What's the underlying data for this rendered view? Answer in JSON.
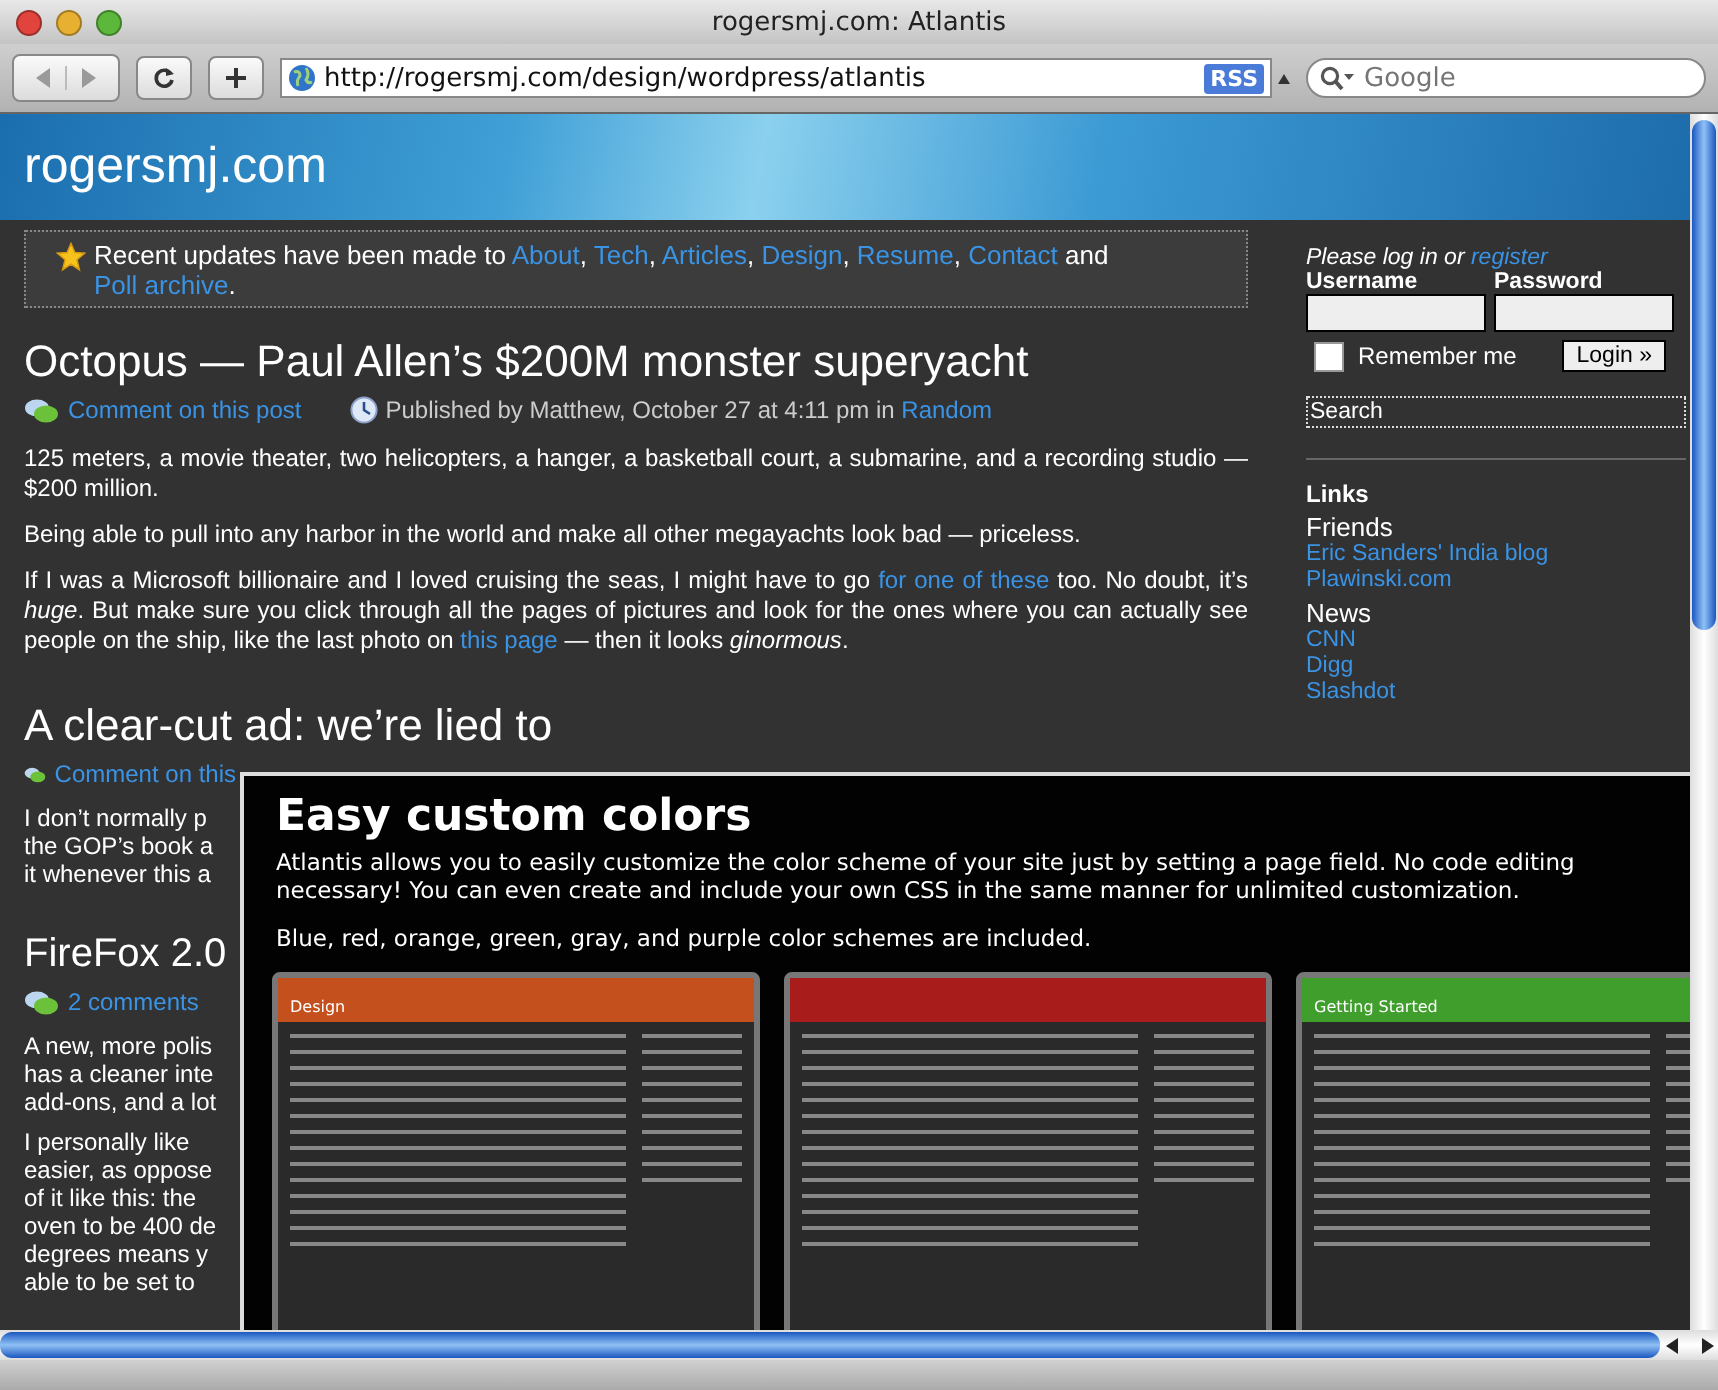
{
  "window": {
    "title": "rogersmj.com: Atlantis"
  },
  "toolbar": {
    "url": "http://rogersmj.com/design/wordpress/atlantis",
    "rss_badge": "RSS",
    "search": {
      "placeholder": "Google"
    }
  },
  "site": {
    "title": "rogersmj.com"
  },
  "notice": [
    {
      "text": "Recent updates have been made to ",
      "link": false
    },
    {
      "text": "About",
      "link": true
    },
    {
      "text": ", ",
      "link": false
    },
    {
      "text": "Tech",
      "link": true
    },
    {
      "text": ", ",
      "link": false
    },
    {
      "text": "Articles",
      "link": true
    },
    {
      "text": ", ",
      "link": false
    },
    {
      "text": "Design",
      "link": true
    },
    {
      "text": ", ",
      "link": false
    },
    {
      "text": "Resume",
      "link": true
    },
    {
      "text": ", ",
      "link": false
    },
    {
      "text": "Contact",
      "link": true
    },
    {
      "text": " and ",
      "link": false
    },
    {
      "text": "Poll archive",
      "link": true
    },
    {
      "text": ".",
      "link": false
    }
  ],
  "post": {
    "title": "Octopus — Paul Allen’s $200M monster superyacht",
    "comment_link": "Comment on this post",
    "meta": "Published by Matthew, October 27 at 4:11 pm in ",
    "category": "Random",
    "paragraphs": [
      [
        {
          "text": "125 meters, a movie theater, two helicopters, a hanger, a basketball court, a submarine, and a recording studio — $200 million.",
          "link": false
        }
      ],
      [
        {
          "text": "Being able to pull into any harbor in the world and make all other megayachts look bad — priceless.",
          "link": false
        }
      ],
      [
        {
          "text": "If I was a Microsoft billionaire and I loved cruising the seas, I might have to go ",
          "link": false
        },
        {
          "text": "for one of these",
          "link": true
        },
        {
          "text": " too. No doubt, it’s *huge*. But make sure you click through all the pages of pictures and look for the ones where you can actually see people on the ship, like the last photo on ",
          "link": false
        },
        {
          "text": "this page",
          "link": true
        },
        {
          "text": " — then it looks *ginormous*.",
          "link": false
        }
      ]
    ]
  },
  "next_post_title": "A clear-cut ad: we’re lied to",
  "partial_posts": [
    {
      "comment_link": "Comment on this",
      "paragraphs": [
        [
          "I don’t normally p",
          "the GOP’s book a",
          "it whenever this a"
        ]
      ]
    },
    {
      "title": "FireFox 2.0",
      "comment_link": "2 comments",
      "paragraphs": [
        [
          "A new, more polis",
          "has a cleaner inte",
          "add-ons, and a lot"
        ],
        [
          "I personally like",
          "easier, as oppose",
          "of it like this: the",
          "oven to be 400 de",
          "degrees means y",
          "able to be set to"
        ]
      ]
    }
  ],
  "sidebar": {
    "login_prompt": "Please log in or ",
    "register_link": "register",
    "username_label": "Username",
    "password_label": "Password",
    "remember": {
      "label": "Remember me",
      "checked": false
    },
    "login_button": "Login »",
    "search": {
      "value": "Search"
    },
    "links_title": "Links",
    "groups": [
      {
        "title": "Friends",
        "links": [
          "Eric Sanders' India blog",
          "Plawinski.com"
        ]
      },
      {
        "title": "News",
        "links": [
          "CNN",
          "Digg",
          "Slashdot"
        ]
      }
    ]
  },
  "overlay": {
    "title": "Easy custom colors",
    "paragraphs": [
      "Atlantis allows you to easily customize the color scheme of your site just by setting a page field. No code editing necessary! You can even create and include your own CSS in the same manner for unlimited customization.",
      "Blue, red, orange, green, gray, and purple color schemes are included."
    ],
    "thumbnails": [
      {
        "title": "Design",
        "color": "#c4501e"
      },
      {
        "color": "#a81c1c"
      },
      {
        "title": "Getting Started",
        "color": "#3f9e2c"
      }
    ]
  }
}
